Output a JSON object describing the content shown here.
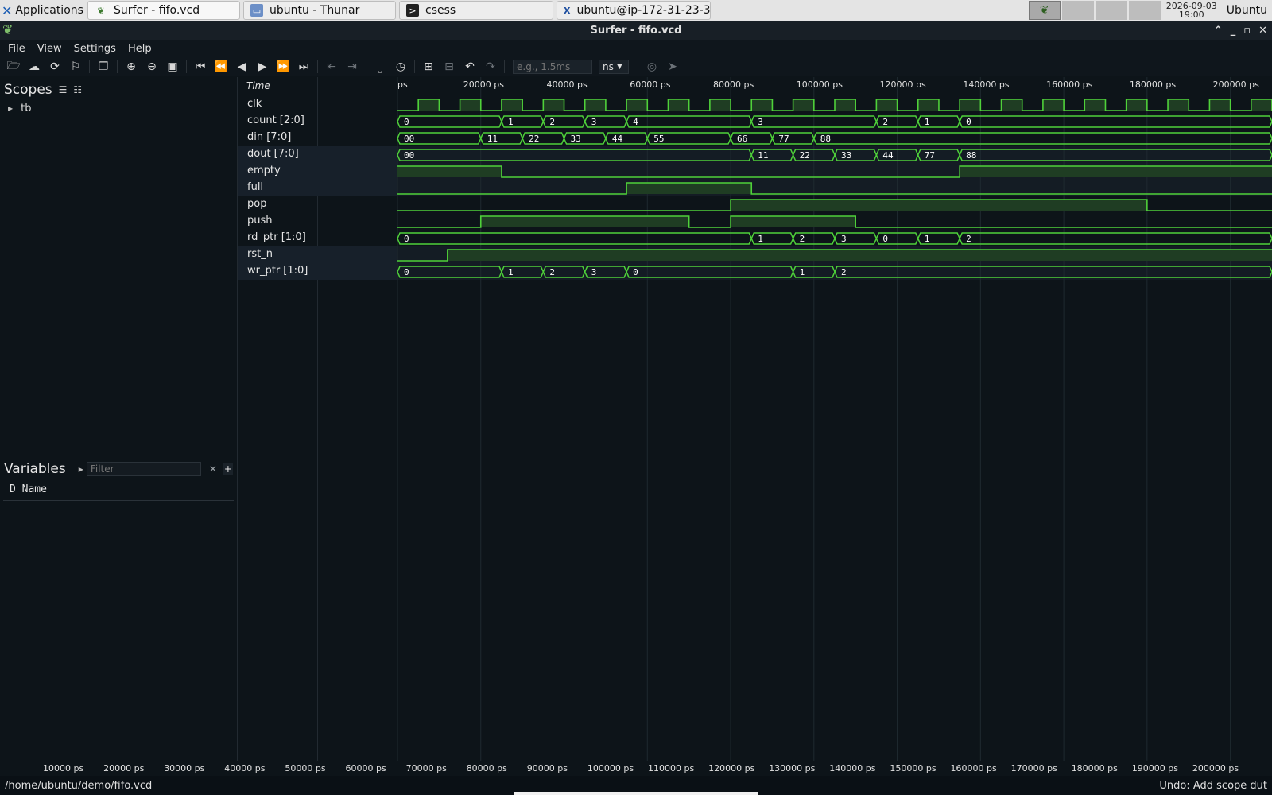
{
  "taskbar": {
    "applications_label": "Applications",
    "tasks": [
      {
        "label": "Surfer - fifo.vcd",
        "icon": "surfer-icon"
      },
      {
        "label": "ubuntu - Thunar",
        "icon": "folder-icon"
      },
      {
        "label": "csess",
        "icon": "terminal-icon"
      },
      {
        "label": "ubuntu@ip-172-31-23-3...",
        "icon": "xterm-icon"
      }
    ],
    "clock_date": "2026-09-03",
    "clock_time": "19:00",
    "user": "Ubuntu"
  },
  "window": {
    "title": "Surfer - fifo.vcd"
  },
  "menu": [
    "File",
    "View",
    "Settings",
    "Help"
  ],
  "toolbar": {
    "time_placeholder": "e.g., 1.5ms",
    "unit": "ns"
  },
  "scopes": {
    "title": "Scopes",
    "items": [
      "tb"
    ]
  },
  "variables": {
    "title": "Variables",
    "filter_placeholder": "Filter",
    "columns": "D Name"
  },
  "waveform": {
    "time_label": "Time",
    "top_ruler": [
      "ps",
      "20000 ps",
      "40000 ps",
      "60000 ps",
      "80000 ps",
      "100000 ps",
      "120000 ps",
      "140000 ps",
      "160000 ps",
      "180000 ps",
      "200000 ps"
    ],
    "bottom_ruler": [
      "10000 ps",
      "20000 ps",
      "30000 ps",
      "40000 ps",
      "50000 ps",
      "60000 ps",
      "70000 ps",
      "80000 ps",
      "90000 ps",
      "100000 ps",
      "110000 ps",
      "120000 ps",
      "130000 ps",
      "140000 ps",
      "150000 ps",
      "160000 ps",
      "170000 ps",
      "180000 ps",
      "190000 ps",
      "200000 ps"
    ],
    "wave_color": "#4fd13a",
    "high_fill": "#1f3d23",
    "signals": [
      {
        "name": "clk",
        "kind": "clock"
      },
      {
        "name": "count [2:0]",
        "kind": "bus",
        "segments": [
          [
            0,
            25000,
            "0"
          ],
          [
            25000,
            35000,
            "1"
          ],
          [
            35000,
            45000,
            "2"
          ],
          [
            45000,
            55000,
            "3"
          ],
          [
            55000,
            85000,
            "4"
          ],
          [
            85000,
            115000,
            "3"
          ],
          [
            115000,
            125000,
            "2"
          ],
          [
            125000,
            135000,
            "1"
          ],
          [
            135000,
            210000,
            "0"
          ]
        ]
      },
      {
        "name": "din [7:0]",
        "kind": "bus",
        "segments": [
          [
            0,
            20000,
            "00"
          ],
          [
            20000,
            30000,
            "11"
          ],
          [
            30000,
            40000,
            "22"
          ],
          [
            40000,
            50000,
            "33"
          ],
          [
            50000,
            60000,
            "44"
          ],
          [
            60000,
            80000,
            "55"
          ],
          [
            80000,
            90000,
            "66"
          ],
          [
            90000,
            100000,
            "77"
          ],
          [
            100000,
            210000,
            "88"
          ]
        ]
      },
      {
        "name": "dout [7:0]",
        "kind": "bus",
        "shaded": true,
        "segments": [
          [
            0,
            85000,
            "00"
          ],
          [
            85000,
            95000,
            "11"
          ],
          [
            95000,
            105000,
            "22"
          ],
          [
            105000,
            115000,
            "33"
          ],
          [
            115000,
            125000,
            "44"
          ],
          [
            125000,
            135000,
            "77"
          ],
          [
            135000,
            210000,
            "88"
          ]
        ]
      },
      {
        "name": "empty",
        "kind": "bit",
        "shaded": true,
        "init": 1,
        "changes": [
          25000,
          135000
        ]
      },
      {
        "name": "full",
        "kind": "bit",
        "shaded": true,
        "init": 0,
        "changes": [
          55000,
          85000
        ]
      },
      {
        "name": "pop",
        "kind": "bit",
        "init": 0,
        "changes": [
          80000,
          180000
        ]
      },
      {
        "name": "push",
        "kind": "bit",
        "init": 0,
        "changes": [
          20000,
          70000,
          80000,
          110000
        ]
      },
      {
        "name": "rd_ptr [1:0]",
        "kind": "bus",
        "segments": [
          [
            0,
            85000,
            "0"
          ],
          [
            85000,
            95000,
            "1"
          ],
          [
            95000,
            105000,
            "2"
          ],
          [
            105000,
            115000,
            "3"
          ],
          [
            115000,
            125000,
            "0"
          ],
          [
            125000,
            135000,
            "1"
          ],
          [
            135000,
            210000,
            "2"
          ]
        ]
      },
      {
        "name": "rst_n",
        "kind": "bit",
        "shaded": true,
        "init": 0,
        "changes": [
          12000
        ]
      },
      {
        "name": "wr_ptr [1:0]",
        "kind": "bus",
        "shaded": true,
        "segments": [
          [
            0,
            25000,
            "0"
          ],
          [
            25000,
            35000,
            "1"
          ],
          [
            35000,
            45000,
            "2"
          ],
          [
            45000,
            55000,
            "3"
          ],
          [
            55000,
            95000,
            "0"
          ],
          [
            95000,
            105000,
            "1"
          ],
          [
            105000,
            210000,
            "2"
          ]
        ]
      }
    ]
  },
  "status": {
    "path": "/home/ubuntu/demo/fifo.vcd",
    "message": "Undo: Add scope dut"
  }
}
